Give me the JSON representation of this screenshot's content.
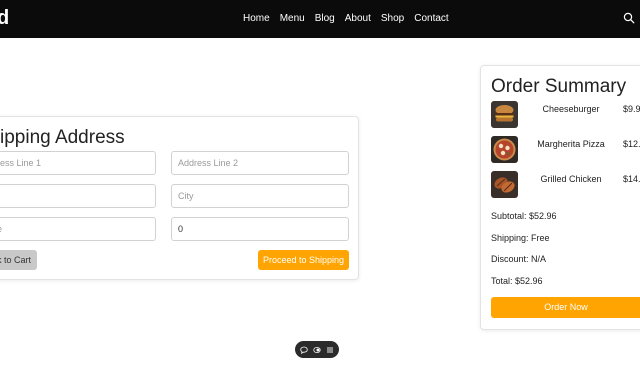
{
  "brand": {
    "text": "d"
  },
  "nav": {
    "items": [
      "Home",
      "Menu",
      "Blog",
      "About",
      "Shop",
      "Contact"
    ]
  },
  "shipping": {
    "title": "ipping Address",
    "address1_placeholder": "ress Line 1",
    "address2_placeholder": "Address Line 2",
    "city_placeholder": "City",
    "state_placeholder": "e",
    "zip_value": "0",
    "back_label": "k to Cart",
    "proceed_label": "Proceed to Shipping"
  },
  "summary": {
    "title": "Order Summary",
    "items": [
      {
        "name": "Cheeseburger",
        "price": "$9.9"
      },
      {
        "name": "Margherita Pizza",
        "price": "$12.9"
      },
      {
        "name": "Grilled Chicken",
        "price": "$14.9"
      }
    ],
    "subtotal": "Subtotal: $52.96",
    "shipping": "Shipping: Free",
    "discount": "Discount: N/A",
    "total": "Total: $52.96",
    "order_label": "Order Now"
  },
  "colors": {
    "accent": "#ffa400",
    "nav_bg": "#0b0b0b",
    "back_btn": "#c9c9c9"
  },
  "icons": {
    "search": "search-icon",
    "chat": "chat-icon",
    "theme": "theme-toggle-icon",
    "menu": "menu-icon"
  }
}
